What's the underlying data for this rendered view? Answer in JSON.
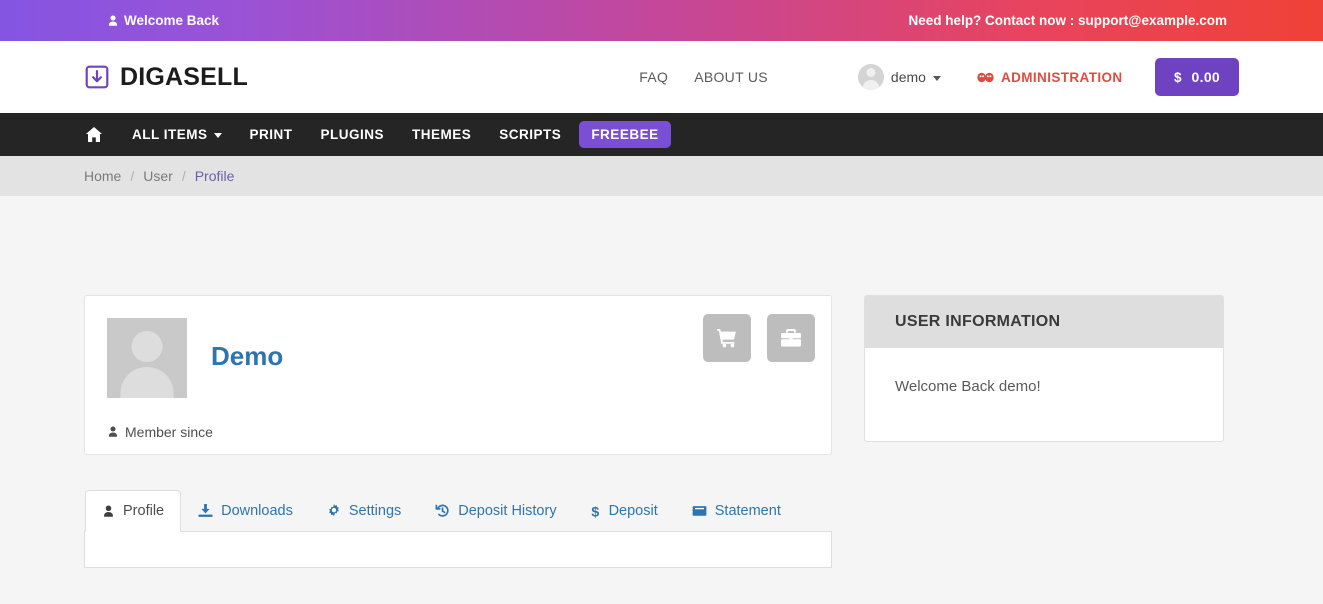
{
  "topbar": {
    "welcome_text": "Welcome Back",
    "welcome_icon": "user-icon",
    "help_text": "Need help? Contact now : support@example.com",
    "gradient_start": "#8455e2",
    "gradient_mid": "#c4479a",
    "gradient_end": "#ef4136"
  },
  "header": {
    "brand_name": "DIGASELL",
    "brand_icon": "download-box-icon",
    "brand_color": "#6f42c1",
    "nav": [
      {
        "label": "FAQ",
        "name": "header-nav-faq"
      },
      {
        "label": "ABOUT US",
        "name": "header-nav-about-us"
      }
    ],
    "user": {
      "name": "demo",
      "avatar_icon": "user-avatar-icon",
      "caret_icon": "chevron-down-icon"
    },
    "administration": {
      "label": "ADMINISTRATION",
      "icon": "admin-mask-icon",
      "color": "#e04b41"
    },
    "balance": {
      "currency_icon": "dollar-icon",
      "amount": "0.00",
      "color": "#6f42c1"
    }
  },
  "mainnav": {
    "home_icon": "home-icon",
    "items": [
      {
        "label": "ALL ITEMS",
        "name": "nav-all-items",
        "has_caret": true
      },
      {
        "label": "PRINT",
        "name": "nav-print",
        "has_caret": false
      },
      {
        "label": "PLUGINS",
        "name": "nav-plugins",
        "has_caret": false
      },
      {
        "label": "THEMES",
        "name": "nav-themes",
        "has_caret": false
      },
      {
        "label": "SCRIPTS",
        "name": "nav-scripts",
        "has_caret": false
      }
    ],
    "highlight": {
      "label": "FREEBEE",
      "color": "#7b4fd4"
    }
  },
  "breadcrumb": {
    "items": [
      {
        "label": "Home",
        "active": false
      },
      {
        "label": "User",
        "active": false
      },
      {
        "label": "Profile",
        "active": true
      }
    ],
    "separator": "/"
  },
  "profile": {
    "name": "Demo",
    "name_color": "#2e75af",
    "avatar_icon": "user-placeholder-icon",
    "member_since_label": "Member since",
    "member_since_icon": "user-icon",
    "actions": [
      {
        "name": "cart-button",
        "icon": "shopping-cart-icon"
      },
      {
        "name": "briefcase-button",
        "icon": "briefcase-icon"
      }
    ]
  },
  "tabs": [
    {
      "label": "Profile",
      "icon": "user-icon",
      "active": true
    },
    {
      "label": "Downloads",
      "icon": "download-icon",
      "active": false
    },
    {
      "label": "Settings",
      "icon": "gear-icon",
      "active": false
    },
    {
      "label": "Deposit History",
      "icon": "history-icon",
      "active": false
    },
    {
      "label": "Deposit",
      "icon": "dollar-icon",
      "active": false
    },
    {
      "label": "Statement",
      "icon": "book-icon",
      "active": false
    }
  ],
  "user_information": {
    "title": "USER INFORMATION",
    "body": "Welcome Back demo!"
  }
}
